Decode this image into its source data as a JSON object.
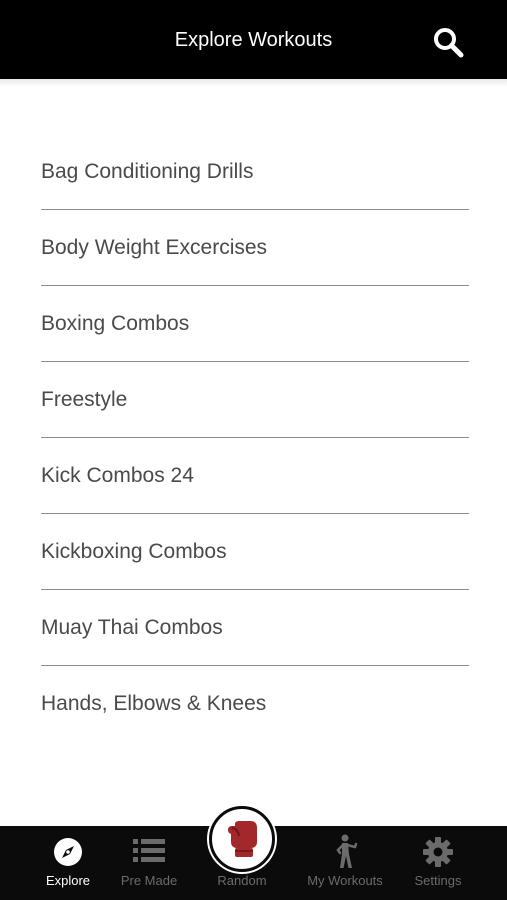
{
  "header": {
    "title": "Explore Workouts",
    "search_icon": "search-icon"
  },
  "workouts": [
    "Bag Conditioning Drills",
    "Body Weight Excercises",
    "Boxing Combos",
    "Freestyle",
    "Kick Combos 24",
    "Kickboxing Combos",
    "Muay Thai Combos",
    "Hands, Elbows & Knees"
  ],
  "tabbar": {
    "tabs": [
      {
        "label": "Explore",
        "icon": "compass-icon",
        "active": true
      },
      {
        "label": "Pre Made",
        "icon": "list-icon",
        "active": false
      },
      {
        "label": "Random",
        "icon": "boxing-glove-icon",
        "active": false
      },
      {
        "label": "My Workouts",
        "icon": "fighter-icon",
        "active": false
      },
      {
        "label": "Settings",
        "icon": "gear-icon",
        "active": false
      }
    ]
  },
  "colors": {
    "header_bg": "#000000",
    "tabbar_bg": "#0b0b0b",
    "glove_red": "#a3282c",
    "divider": "#8c8c8c",
    "text": "#4a4a4a"
  }
}
